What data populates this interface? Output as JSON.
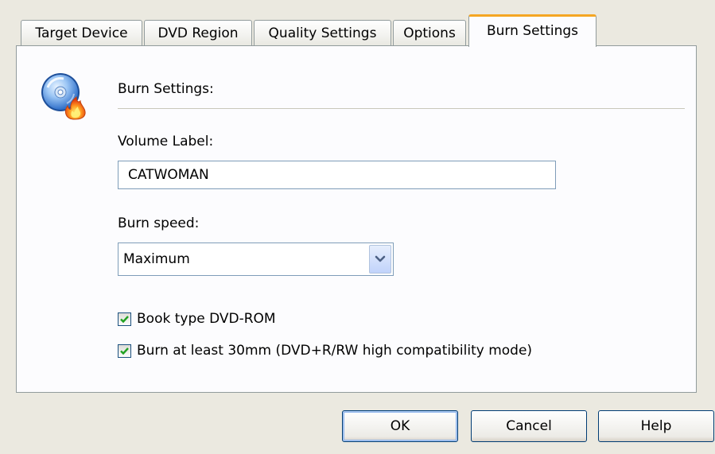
{
  "tabs": [
    {
      "label": "Target Device"
    },
    {
      "label": "DVD Region"
    },
    {
      "label": "Quality Settings"
    },
    {
      "label": "Options"
    },
    {
      "label": "Burn Settings"
    }
  ],
  "active_tab": "Burn Settings",
  "panel": {
    "section_title": "Burn Settings:",
    "icon": "cd-burn-icon",
    "volume_label": {
      "label": "Volume Label:",
      "value": "CATWOMAN"
    },
    "burn_speed": {
      "label": "Burn speed:",
      "value": "Maximum"
    },
    "checkboxes": [
      {
        "label": "Book type DVD-ROM",
        "checked": true
      },
      {
        "label": "Burn at least 30mm (DVD+R/RW high compatibility mode)",
        "checked": true
      }
    ]
  },
  "buttons": {
    "ok": "OK",
    "cancel": "Cancel",
    "help": "Help"
  },
  "colors": {
    "dialog_bg": "#ebe9e0",
    "panel_bg": "#fcfcfe",
    "active_tab_accent": "#f5a623",
    "checkmark": "#21a121",
    "field_border": "#7f9db9"
  }
}
